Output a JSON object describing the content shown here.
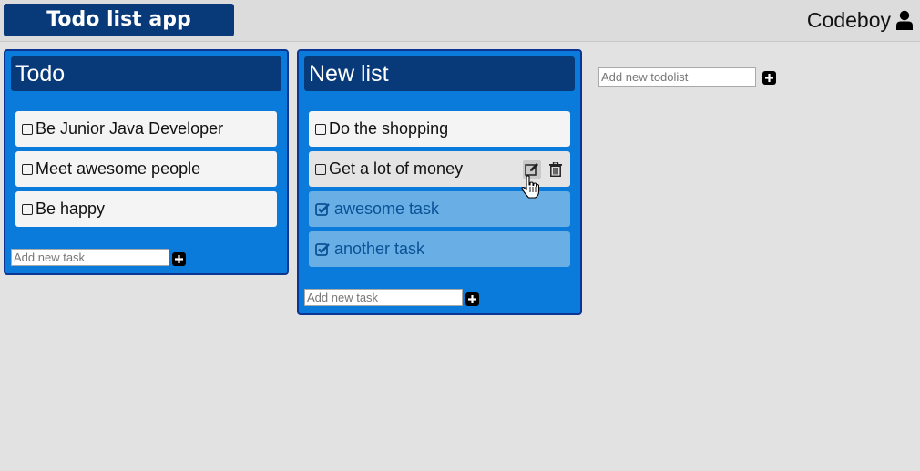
{
  "header": {
    "app_title": "Todo list app",
    "username": "Codeboy",
    "user_icon": "user-icon"
  },
  "lists": [
    {
      "title": "Todo",
      "tasks": [
        {
          "label": "Be Junior Java Developer",
          "done": false
        },
        {
          "label": "Meet awesome people",
          "done": false
        },
        {
          "label": "Be happy",
          "done": false
        }
      ],
      "add_task_placeholder": "Add new task"
    },
    {
      "title": "New list",
      "tasks": [
        {
          "label": "Do the shopping",
          "done": false
        },
        {
          "label": "Get a lot of money",
          "done": false,
          "hovered": true
        },
        {
          "label": "awesome task",
          "done": true
        },
        {
          "label": "another task",
          "done": true
        }
      ],
      "add_task_placeholder": "Add new task"
    }
  ],
  "new_todolist": {
    "placeholder": "Add new todolist"
  },
  "colors": {
    "background": "#e2e2e2",
    "header_dark": "#083a7a",
    "card_blue": "#0a7bdb",
    "card_border": "#0d3591",
    "done_task": "#69aee4",
    "done_text": "#0a5296"
  }
}
